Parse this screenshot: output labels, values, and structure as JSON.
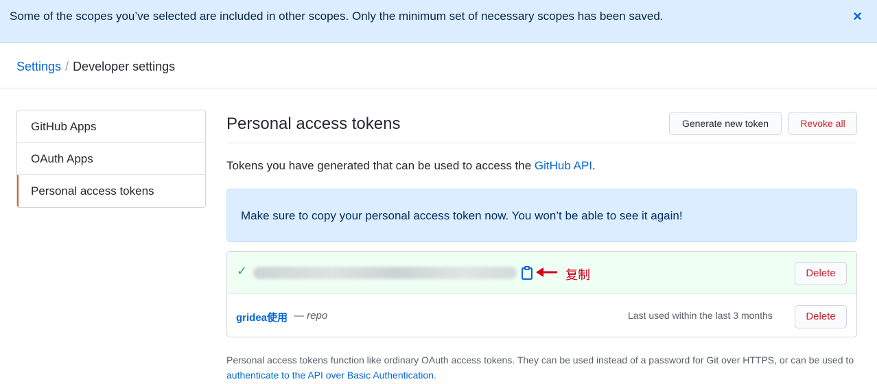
{
  "flash": {
    "message": "Some of the scopes you’ve selected are included in other scopes. Only the minimum set of necessary scopes has been saved.",
    "close_icon": "×"
  },
  "breadcrumb": {
    "parent": "Settings",
    "separator": "/",
    "current": "Developer settings"
  },
  "sidebar": {
    "items": [
      {
        "label": "GitHub Apps",
        "selected": false
      },
      {
        "label": "OAuth Apps",
        "selected": false
      },
      {
        "label": "Personal access tokens",
        "selected": true
      }
    ]
  },
  "main": {
    "title": "Personal access tokens",
    "generate_button": "Generate new token",
    "revoke_button": "Revoke all",
    "intro_prefix": "Tokens you have generated that can be used to access the ",
    "intro_link": "GitHub API",
    "intro_suffix": ".",
    "notice": "Make sure to copy your personal access token now. You won’t be able to see it again!"
  },
  "tokens": {
    "new_token": {
      "check_icon": "✓",
      "copy_icon": "clipboard-icon",
      "annotation": "复制",
      "delete_label": "Delete"
    },
    "rows": [
      {
        "name": "gridea使用",
        "dash": " — ",
        "scope": "repo",
        "last_used": "Last used within the last 3 months",
        "delete_label": "Delete"
      }
    ]
  },
  "footer": {
    "text_prefix": "Personal access tokens function like ordinary OAuth access tokens. They can be used instead of a password for Git over HTTPS, or can be used to ",
    "link": "authenticate to the API over Basic Authentication",
    "text_suffix": "."
  },
  "colors": {
    "link": "#0366d6",
    "danger": "#cb2431",
    "success": "#28a745",
    "flash_bg": "#dbedff",
    "annotation_red": "#d0021b"
  }
}
